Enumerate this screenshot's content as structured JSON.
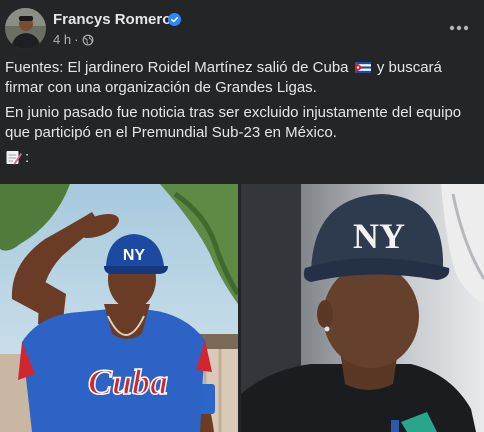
{
  "post": {
    "author": "Francys Romero",
    "verified_icon": "verified-badge-icon",
    "time": "4 h",
    "separator": "·",
    "audience_icon": "globe-icon",
    "more_icon": "more-options-icon",
    "paragraph1_a": "Fuentes: El jardinero Roidel Martínez salió de Cuba",
    "paragraph1_b": "y buscará firmar con una organización de Grandes Ligas.",
    "paragraph2": "En junio pasado fue noticia tras ser excluido injustamente del equipo que participó en el Premundial Sub-23 en México.",
    "memo_suffix": ":",
    "photo1_jersey_text": "Cuba",
    "photo1_cap_text": "NY",
    "photo2_cap_text": "NY"
  },
  "colors": {
    "background": "#242526",
    "text_primary": "#e4e6eb",
    "text_secondary": "#b0b3b8",
    "verified_blue": "#2d88ff"
  }
}
